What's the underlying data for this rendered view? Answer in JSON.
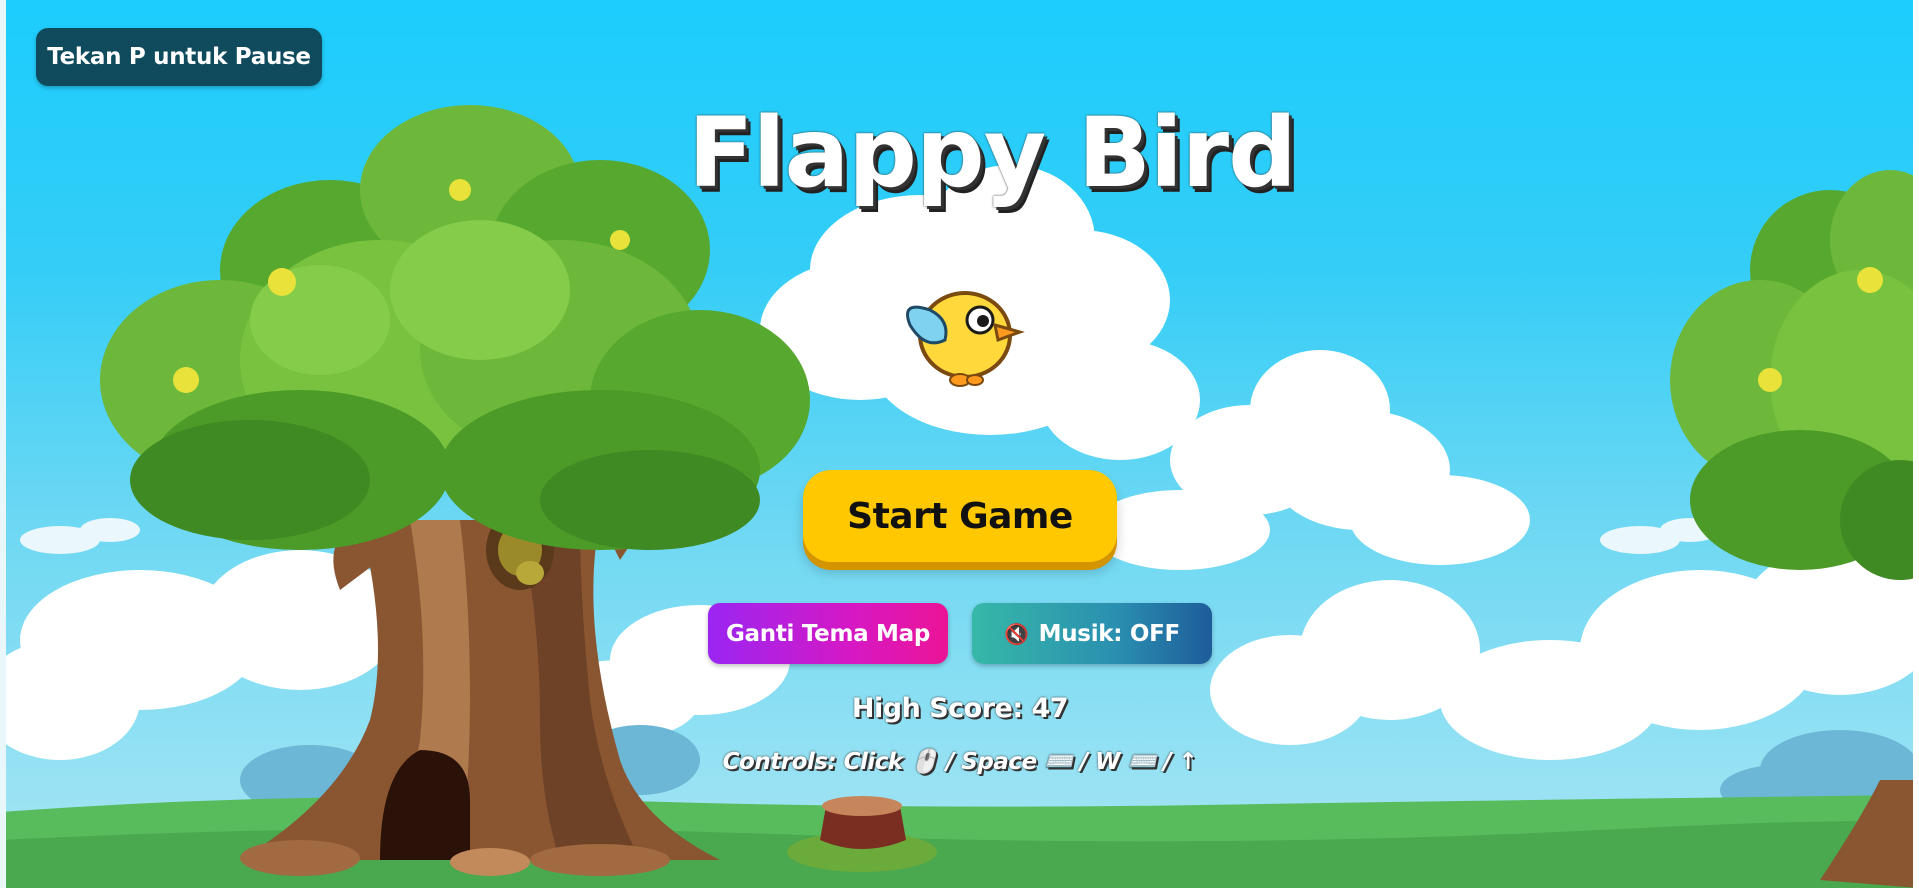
{
  "hud": {
    "pause_hint": "Tekan P untuk Pause"
  },
  "menu": {
    "title": "Flappy Bird",
    "start_label": "Start Game",
    "theme_label": "Ganti Tema Map",
    "music_icon": "muted-speaker-icon",
    "music_label": "Musik: OFF",
    "high_score_label": "High Score: 47",
    "controls_label": "Controls: Click 🖱️ / Space ⌨️ / W ⌨️ / ↑"
  },
  "colors": {
    "sky_top": "#1ccdfd",
    "start_button": "#ffc800",
    "theme_button_gradient": [
      "#9a26f2",
      "#ec1496"
    ],
    "music_button_gradient": [
      "#36b8a8",
      "#1e5c9a"
    ],
    "pause_badge": "#0f4b5c",
    "bird_body": "#ffd93b",
    "bird_wing": "#7fd3f0"
  }
}
